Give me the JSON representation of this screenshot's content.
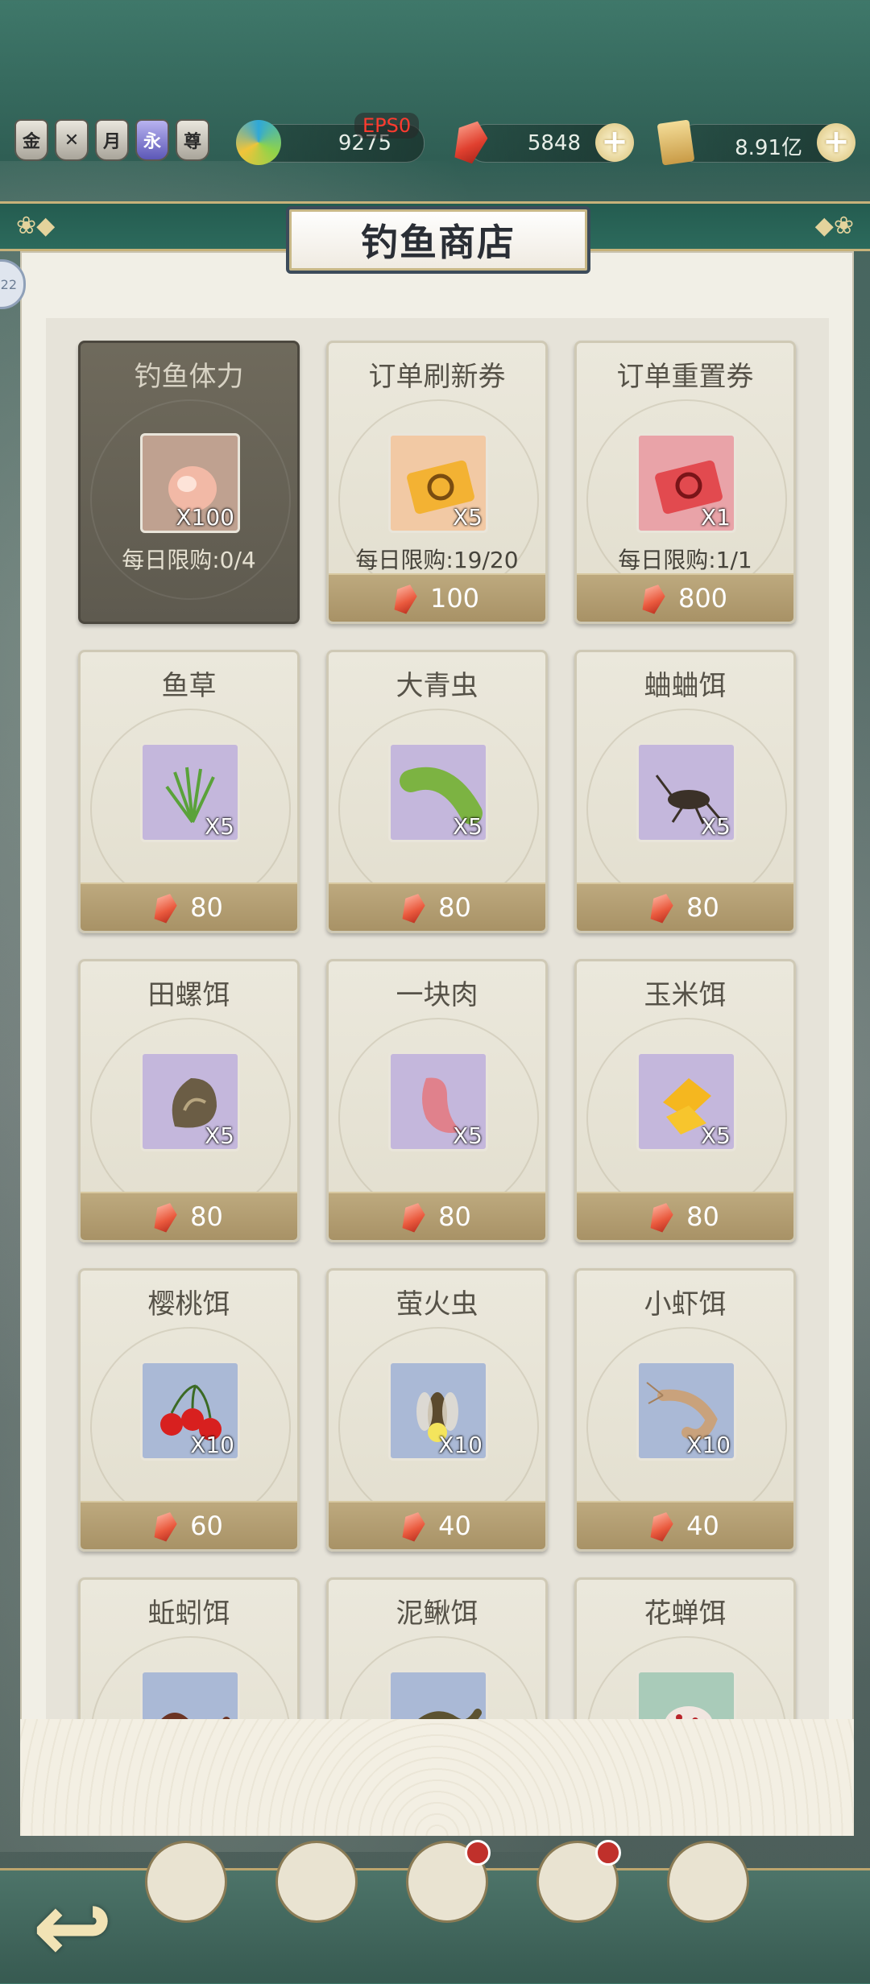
{
  "topbar": {
    "badges": [
      "金",
      "",
      "月",
      "永",
      "尊"
    ],
    "fps": "EPS0",
    "jade": "9275",
    "gems": "5848",
    "coins": "8.91亿",
    "plus": "+"
  },
  "shop": {
    "title": "钓鱼商店",
    "side_tab": "22",
    "items": [
      {
        "name": "钓鱼体力",
        "qty": "X100",
        "limit": "每日限购:0/4",
        "price": "",
        "sold_out": true,
        "icon": "peach-icon",
        "slot": "peach"
      },
      {
        "name": "订单刷新券",
        "qty": "X5",
        "limit": "每日限购:19/20",
        "price": "100",
        "icon": "refresh-ticket-icon",
        "slot": "orange"
      },
      {
        "name": "订单重置券",
        "qty": "X1",
        "limit": "每日限购:1/1",
        "price": "800",
        "icon": "reset-ticket-icon",
        "slot": "pink"
      },
      {
        "name": "鱼草",
        "qty": "X5",
        "price": "80",
        "icon": "grass-icon",
        "slot": "purple"
      },
      {
        "name": "大青虫",
        "qty": "X5",
        "price": "80",
        "icon": "caterpillar-icon",
        "slot": "purple"
      },
      {
        "name": "蛐蛐饵",
        "qty": "X5",
        "price": "80",
        "icon": "cricket-icon",
        "slot": "purple"
      },
      {
        "name": "田螺饵",
        "qty": "X5",
        "price": "80",
        "icon": "snail-icon",
        "slot": "purple"
      },
      {
        "name": "一块肉",
        "qty": "X5",
        "price": "80",
        "icon": "meat-icon",
        "slot": "purple"
      },
      {
        "name": "玉米饵",
        "qty": "X5",
        "price": "80",
        "icon": "corn-icon",
        "slot": "purple"
      },
      {
        "name": "樱桃饵",
        "qty": "X10",
        "price": "60",
        "icon": "cherry-icon",
        "slot": "blue"
      },
      {
        "name": "萤火虫",
        "qty": "X10",
        "price": "40",
        "icon": "firefly-icon",
        "slot": "blue"
      },
      {
        "name": "小虾饵",
        "qty": "X10",
        "price": "40",
        "icon": "shrimp-icon",
        "slot": "blue"
      },
      {
        "name": "蚯蚓饵",
        "icon": "worm-icon",
        "slot": "blue"
      },
      {
        "name": "泥鳅饵",
        "icon": "loach-icon",
        "slot": "blue"
      },
      {
        "name": "花蝉饵",
        "icon": "cicada-icon",
        "slot": "teal"
      }
    ]
  },
  "nav": [
    "",
    "",
    "",
    "",
    ""
  ],
  "back_label": "↩"
}
